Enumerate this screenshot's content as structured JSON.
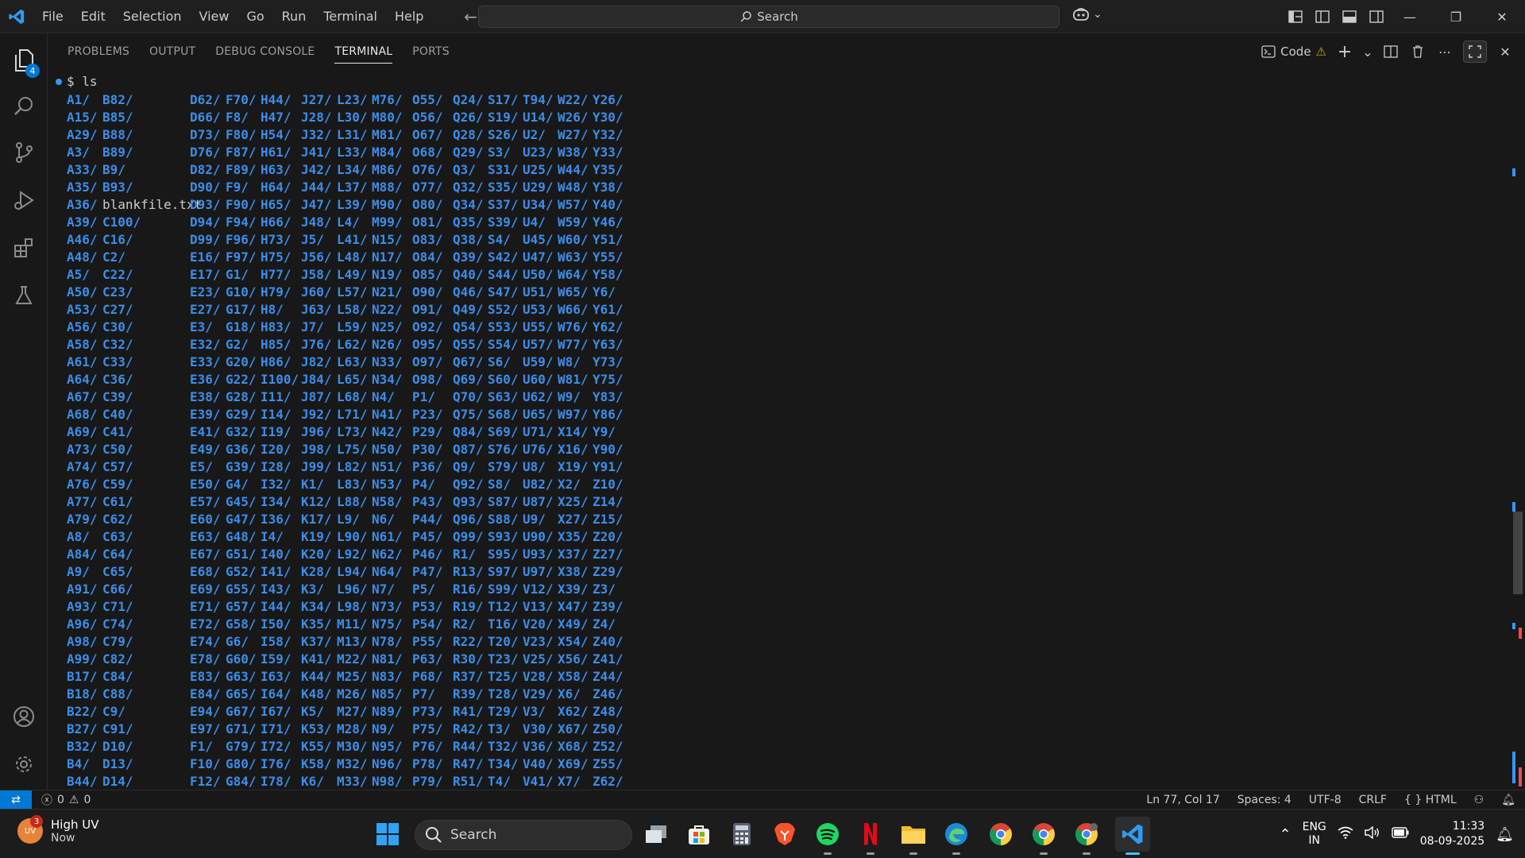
{
  "menu": [
    "File",
    "Edit",
    "Selection",
    "View",
    "Go",
    "Run",
    "Terminal",
    "Help"
  ],
  "search_label": "Search",
  "activity": {
    "explorer_badge": "4"
  },
  "panel_tabs": [
    "PROBLEMS",
    "OUTPUT",
    "DEBUG CONSOLE",
    "TERMINAL",
    "PORTS"
  ],
  "active_tab": "TERMINAL",
  "terminal_name": "Code",
  "prompt": "$ ls",
  "listing": [
    [
      "A1/",
      "A15/",
      "A29/",
      "A3/",
      "A33/",
      "A35/",
      "A36/",
      "A39/",
      "A46/",
      "A48/",
      "A5/",
      "A50/",
      "A53/",
      "A56/",
      "A58/",
      "A61/",
      "A64/",
      "A67/",
      "A68/",
      "A69/",
      "A73/",
      "A74/",
      "A76/",
      "A77/",
      "A79/",
      "A8/",
      "A84/",
      "A9/",
      "A91/",
      "A93/",
      "A96/",
      "A98/",
      "A99/",
      "B17/",
      "B18/",
      "B22/",
      "B27/",
      "B32/",
      "B4/",
      "B44/"
    ],
    [
      "B82/",
      "B85/",
      "B88/",
      "B89/",
      "B9/",
      "B93/",
      "blankfile.txt",
      "C100/",
      "C16/",
      "C2/",
      "C22/",
      "C23/",
      "C27/",
      "C30/",
      "C32/",
      "C33/",
      "C36/",
      "C39/",
      "C40/",
      "C41/",
      "C50/",
      "C57/",
      "C59/",
      "C61/",
      "C62/",
      "C63/",
      "C64/",
      "C65/",
      "C66/",
      "C71/",
      "C74/",
      "C79/",
      "C82/",
      "C84/",
      "C88/",
      "C9/",
      "C91/",
      "D10/",
      "D13/",
      "D14/"
    ],
    [
      "D62/",
      "D66/",
      "D73/",
      "D76/",
      "D82/",
      "D90/",
      "D93/",
      "D94/",
      "D99/",
      "E16/",
      "E17/",
      "E23/",
      "E27/",
      "E3/",
      "E32/",
      "E33/",
      "E36/",
      "E38/",
      "E39/",
      "E41/",
      "E49/",
      "E5/",
      "E50/",
      "E57/",
      "E60/",
      "E63/",
      "E67/",
      "E68/",
      "E69/",
      "E71/",
      "E72/",
      "E74/",
      "E78/",
      "E83/",
      "E84/",
      "E94/",
      "E97/",
      "F1/",
      "F10/",
      "F12/"
    ],
    [
      "F70/",
      "F8/",
      "F80/",
      "F87/",
      "F89/",
      "F9/",
      "F90/",
      "F94/",
      "F96/",
      "F97/",
      "G1/",
      "G10/",
      "G17/",
      "G18/",
      "G2/",
      "G20/",
      "G22/",
      "G28/",
      "G29/",
      "G32/",
      "G36/",
      "G39/",
      "G4/",
      "G45/",
      "G47/",
      "G48/",
      "G51/",
      "G52/",
      "G55/",
      "G57/",
      "G58/",
      "G6/",
      "G60/",
      "G63/",
      "G65/",
      "G67/",
      "G71/",
      "G79/",
      "G80/",
      "G84/"
    ],
    [
      "H44/",
      "H47/",
      "H54/",
      "H61/",
      "H63/",
      "H64/",
      "H65/",
      "H66/",
      "H73/",
      "H75/",
      "H77/",
      "H79/",
      "H8/",
      "H83/",
      "H85/",
      "H86/",
      "I100/",
      "I11/",
      "I14/",
      "I19/",
      "I20/",
      "I28/",
      "I32/",
      "I34/",
      "I36/",
      "I4/",
      "I40/",
      "I41/",
      "I43/",
      "I44/",
      "I50/",
      "I58/",
      "I59/",
      "I63/",
      "I64/",
      "I67/",
      "I71/",
      "I72/",
      "I76/",
      "I78/"
    ],
    [
      "J27/",
      "J28/",
      "J32/",
      "J41/",
      "J42/",
      "J44/",
      "J47/",
      "J48/",
      "J5/",
      "J56/",
      "J58/",
      "J60/",
      "J63/",
      "J7/",
      "J76/",
      "J82/",
      "J84/",
      "J87/",
      "J92/",
      "J96/",
      "J98/",
      "J99/",
      "K1/",
      "K12/",
      "K17/",
      "K19/",
      "K20/",
      "K28/",
      "K3/",
      "K34/",
      "K35/",
      "K37/",
      "K41/",
      "K44/",
      "K48/",
      "K5/",
      "K53/",
      "K55/",
      "K58/",
      "K6/"
    ],
    [
      "L23/",
      "L30/",
      "L31/",
      "L33/",
      "L34/",
      "L37/",
      "L39/",
      "L4/",
      "L41/",
      "L48/",
      "L49/",
      "L57/",
      "L58/",
      "L59/",
      "L62/",
      "L63/",
      "L65/",
      "L68/",
      "L71/",
      "L73/",
      "L75/",
      "L82/",
      "L83/",
      "L88/",
      "L9/",
      "L90/",
      "L92/",
      "L94/",
      "L96/",
      "L98/",
      "M11/",
      "M13/",
      "M22/",
      "M25/",
      "M26/",
      "M27/",
      "M28/",
      "M30/",
      "M32/",
      "M33/"
    ],
    [
      "M76/",
      "M80/",
      "M81/",
      "M84/",
      "M86/",
      "M88/",
      "M90/",
      "M99/",
      "N15/",
      "N17/",
      "N19/",
      "N21/",
      "N22/",
      "N25/",
      "N26/",
      "N33/",
      "N34/",
      "N4/",
      "N41/",
      "N42/",
      "N50/",
      "N51/",
      "N53/",
      "N58/",
      "N6/",
      "N61/",
      "N62/",
      "N64/",
      "N7/",
      "N73/",
      "N75/",
      "N78/",
      "N81/",
      "N83/",
      "N85/",
      "N89/",
      "N9/",
      "N95/",
      "N96/",
      "N98/"
    ],
    [
      "O55/",
      "O56/",
      "O67/",
      "O68/",
      "O76/",
      "O77/",
      "O80/",
      "O81/",
      "O83/",
      "O84/",
      "O85/",
      "O90/",
      "O91/",
      "O92/",
      "O95/",
      "O97/",
      "O98/",
      "P1/",
      "P23/",
      "P29/",
      "P30/",
      "P36/",
      "P4/",
      "P43/",
      "P44/",
      "P45/",
      "P46/",
      "P47/",
      "P5/",
      "P53/",
      "P54/",
      "P55/",
      "P63/",
      "P68/",
      "P7/",
      "P73/",
      "P75/",
      "P76/",
      "P78/",
      "P79/"
    ],
    [
      "Q24/",
      "Q26/",
      "Q28/",
      "Q29/",
      "Q3/",
      "Q32/",
      "Q34/",
      "Q35/",
      "Q38/",
      "Q39/",
      "Q40/",
      "Q46/",
      "Q49/",
      "Q54/",
      "Q55/",
      "Q67/",
      "Q69/",
      "Q70/",
      "Q75/",
      "Q84/",
      "Q87/",
      "Q9/",
      "Q92/",
      "Q93/",
      "Q96/",
      "Q99/",
      "R1/",
      "R13/",
      "R16/",
      "R19/",
      "R2/",
      "R22/",
      "R30/",
      "R37/",
      "R39/",
      "R41/",
      "R42/",
      "R44/",
      "R47/",
      "R51/"
    ],
    [
      "S17/",
      "S19/",
      "S26/",
      "S3/",
      "S31/",
      "S35/",
      "S37/",
      "S39/",
      "S4/",
      "S42/",
      "S44/",
      "S47/",
      "S52/",
      "S53/",
      "S54/",
      "S6/",
      "S60/",
      "S63/",
      "S68/",
      "S69/",
      "S76/",
      "S79/",
      "S8/",
      "S87/",
      "S88/",
      "S93/",
      "S95/",
      "S97/",
      "S99/",
      "T12/",
      "T16/",
      "T20/",
      "T23/",
      "T25/",
      "T28/",
      "T29/",
      "T3/",
      "T32/",
      "T34/",
      "T4/"
    ],
    [
      "T94/",
      "U14/",
      "U2/",
      "U23/",
      "U25/",
      "U29/",
      "U34/",
      "U4/",
      "U45/",
      "U47/",
      "U50/",
      "U51/",
      "U53/",
      "U55/",
      "U57/",
      "U59/",
      "U60/",
      "U62/",
      "U65/",
      "U71/",
      "U76/",
      "U8/",
      "U82/",
      "U87/",
      "U9/",
      "U90/",
      "U93/",
      "U97/",
      "V12/",
      "V13/",
      "V20/",
      "V23/",
      "V25/",
      "V28/",
      "V29/",
      "V3/",
      "V30/",
      "V36/",
      "V40/",
      "V41/"
    ],
    [
      "W22/",
      "W26/",
      "W27/",
      "W38/",
      "W44/",
      "W48/",
      "W57/",
      "W59/",
      "W60/",
      "W63/",
      "W64/",
      "W65/",
      "W66/",
      "W76/",
      "W77/",
      "W8/",
      "W81/",
      "W9/",
      "W97/",
      "X14/",
      "X16/",
      "X19/",
      "X2/",
      "X25/",
      "X27/",
      "X35/",
      "X37/",
      "X38/",
      "X39/",
      "X47/",
      "X49/",
      "X54/",
      "X56/",
      "X58/",
      "X6/",
      "X62/",
      "X67/",
      "X68/",
      "X69/",
      "X7/"
    ],
    [
      "Y26/",
      "Y30/",
      "Y32/",
      "Y33/",
      "Y35/",
      "Y38/",
      "Y40/",
      "Y46/",
      "Y51/",
      "Y55/",
      "Y58/",
      "Y6/",
      "Y61/",
      "Y62/",
      "Y63/",
      "Y73/",
      "Y75/",
      "Y83/",
      "Y86/",
      "Y9/",
      "Y90/",
      "Y91/",
      "Z10/",
      "Z14/",
      "Z15/",
      "Z20/",
      "Z27/",
      "Z29/",
      "Z3/",
      "Z39/",
      "Z4/",
      "Z40/",
      "Z41/",
      "Z44/",
      "Z46/",
      "Z48/",
      "Z50/",
      "Z52/",
      "Z55/",
      "Z62/"
    ]
  ],
  "status": {
    "errors": "0",
    "warnings": "0",
    "position": "Ln 77, Col 17",
    "spaces": "Spaces: 4",
    "encoding": "UTF-8",
    "eol": "CRLF",
    "language": "HTML"
  },
  "taskbar": {
    "weather_title": "High UV",
    "weather_sub": "Now",
    "weather_badge": "3",
    "search": "Search",
    "lang_top": "ENG",
    "lang_bottom": "IN",
    "time": "11:33",
    "date": "08-09-2025"
  }
}
